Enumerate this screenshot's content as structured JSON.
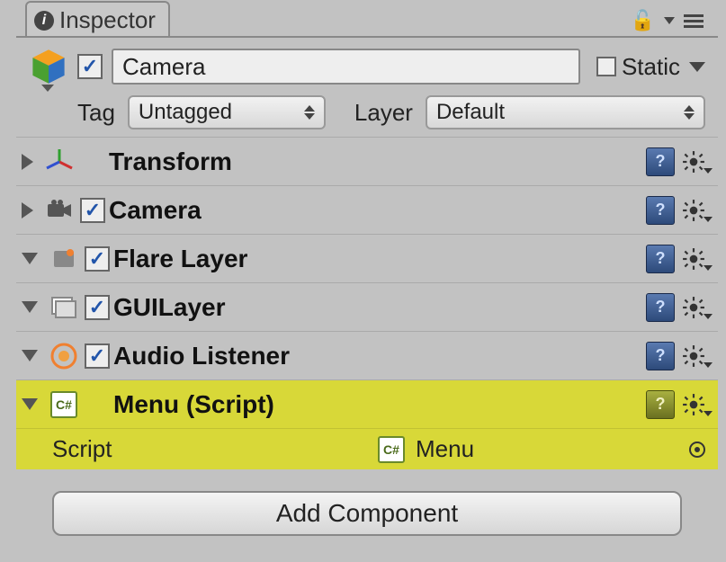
{
  "tab": {
    "title": "Inspector"
  },
  "header": {
    "enabled": true,
    "name": "Camera",
    "static_label": "Static",
    "static_checked": false,
    "tag_label": "Tag",
    "tag_value": "Untagged",
    "layer_label": "Layer",
    "layer_value": "Default"
  },
  "components": [
    {
      "name": "Transform",
      "expanded": false,
      "has_checkbox": false,
      "checked": false,
      "icon": "axis",
      "highlighted": false
    },
    {
      "name": "Camera",
      "expanded": false,
      "has_checkbox": true,
      "checked": true,
      "icon": "camera",
      "highlighted": false
    },
    {
      "name": "Flare Layer",
      "expanded": true,
      "has_checkbox": true,
      "checked": true,
      "icon": "flare",
      "highlighted": false
    },
    {
      "name": "GUILayer",
      "expanded": true,
      "has_checkbox": true,
      "checked": true,
      "icon": "layer",
      "highlighted": false
    },
    {
      "name": "Audio Listener",
      "expanded": true,
      "has_checkbox": true,
      "checked": true,
      "icon": "audio",
      "highlighted": false
    },
    {
      "name": "Menu (Script)",
      "expanded": true,
      "has_checkbox": false,
      "checked": false,
      "icon": "cs",
      "highlighted": true,
      "props": [
        {
          "label": "Script",
          "value": "Menu",
          "icon": "cs"
        }
      ]
    }
  ],
  "add_button": "Add Component"
}
